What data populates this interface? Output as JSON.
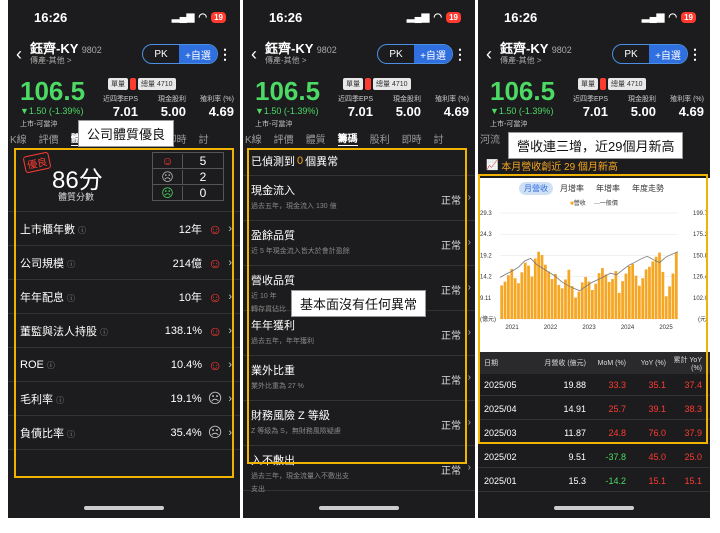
{
  "status": {
    "time": "16:26",
    "battery": "19"
  },
  "header": {
    "name": "鈺齊-KY",
    "code": "9802",
    "sub": "傳產-其他 >",
    "pk": "PK",
    "add": "+自選"
  },
  "quote": {
    "price": "106.5",
    "change": "▼1.50 (-1.39%)",
    "market": "上市-可當沖",
    "tag1": "單量",
    "tag2": "",
    "tag3": "總量 4710",
    "eps_label": "近四季EPS",
    "eps": "7.01",
    "div_label": "現金股利",
    "div": "5.00",
    "yield_label": "殖利率 (%)",
    "yield": "4.69"
  },
  "tabs": [
    "K線",
    "評價",
    "體質",
    "籌碼",
    "股利",
    "即時",
    "討"
  ],
  "tabs_p2": [
    "K線",
    "評價",
    "體質",
    "籌碼",
    "股利",
    "即時",
    "討"
  ],
  "tabs_p3": [
    "河流"
  ],
  "callouts": {
    "p1": "公司體質優良",
    "p2": "基本面沒有任何異常",
    "p3": "營收連三增，近29個月新高"
  },
  "health": {
    "badge": "優良",
    "score": "86分",
    "score_label": "體質分數",
    "counts": [
      {
        "icon": "☺",
        "n": "5"
      },
      {
        "icon": "☹",
        "n": "2"
      },
      {
        "icon": "☹",
        "n": "0"
      }
    ],
    "rows": [
      {
        "label": "上市櫃年數",
        "value": "12年",
        "face": "☺"
      },
      {
        "label": "公司規模",
        "value": "214億",
        "face": "☺"
      },
      {
        "label": "年年配息",
        "value": "10年",
        "face": "☺"
      },
      {
        "label": "董監與法人持股",
        "value": "138.1%",
        "face": "☺"
      },
      {
        "label": "ROE",
        "value": "10.4%",
        "face": "☺"
      },
      {
        "label": "毛利率",
        "value": "19.1%",
        "face": "☹"
      },
      {
        "label": "負債比率",
        "value": "35.4%",
        "face": "☹"
      }
    ]
  },
  "anomaly": {
    "prefix": "已偵測到",
    "count": "0",
    "suffix": "個異常",
    "rows": [
      {
        "title": "現金流入",
        "desc": "過去五年，現金流入 130 億",
        "status": "正常"
      },
      {
        "title": "盈餘品質",
        "desc": "近 5 年現金流入皆大於會計盈餘",
        "status": "正常"
      },
      {
        "title": "營收品質",
        "desc": "近 10 年",
        "desc2": "轉存貨佔比",
        "status": "正常"
      },
      {
        "title": "年年獲利",
        "desc": "過去五年，年年獲利",
        "status": "正常"
      },
      {
        "title": "業外比重",
        "desc": "業外比重為 27 %",
        "status": "正常"
      },
      {
        "title": "財務風險 Z 等級",
        "desc": "Z 等級為 S，無財務風險疑慮",
        "status": "正常"
      },
      {
        "title": "入不敷出",
        "desc": "過去三年，現金流量入不敷出支",
        "desc2": "支出",
        "status": "正常"
      }
    ]
  },
  "revenue": {
    "headline": "本月營收創近 29 個月新高",
    "chart_tabs": [
      "月營收",
      "月增率",
      "年增率",
      "年度走勢"
    ],
    "legend": [
      "營收",
      "一般價"
    ],
    "table_head": [
      "日期",
      "月營收 (億元)",
      "MoM (%)",
      "YoY (%)",
      "累計 YoY (%)"
    ],
    "rows": [
      {
        "date": "2025/05",
        "rev": "19.88",
        "mom": "33.3",
        "yoy": "35.1",
        "cum": "37.4",
        "mom_color": "#ff3b30",
        "yoy_color": "#ff3b30",
        "cum_color": "#ff3b30"
      },
      {
        "date": "2025/04",
        "rev": "14.91",
        "mom": "25.7",
        "yoy": "39.1",
        "cum": "38.3",
        "mom_color": "#ff3b30",
        "yoy_color": "#ff3b30",
        "cum_color": "#ff3b30"
      },
      {
        "date": "2025/03",
        "rev": "11.87",
        "mom": "24.8",
        "yoy": "76.0",
        "cum": "37.9",
        "mom_color": "#ff3b30",
        "yoy_color": "#ff3b30",
        "cum_color": "#ff3b30"
      },
      {
        "date": "2025/02",
        "rev": "9.51",
        "mom": "-37.8",
        "yoy": "45.0",
        "cum": "25.0",
        "mom_color": "#4cd964",
        "yoy_color": "#ff3b30",
        "cum_color": "#ff3b30"
      },
      {
        "date": "2025/01",
        "rev": "15.3",
        "mom": "-14.2",
        "yoy": "15.1",
        "cum": "15.1",
        "mom_color": "#4cd964",
        "yoy_color": "#ff3b30",
        "cum_color": "#ff3b30"
      }
    ]
  },
  "chart_data": {
    "type": "bar",
    "title": "",
    "y_left_ticks": [
      "29.3",
      "24.3",
      "19.2",
      "14.2",
      "9.11",
      "(億元)"
    ],
    "y_right_ticks": [
      "199.7",
      "175.2",
      "150.8",
      "126.4",
      "102.0",
      "(元)"
    ],
    "x_ticks": [
      "2021",
      "2022",
      "2023",
      "2024",
      "2025"
    ],
    "ylim": [
      4.1,
      29.3
    ],
    "bar_values": [
      12.1,
      13.0,
      14.5,
      16.0,
      13.8,
      12.6,
      15.2,
      17.5,
      16.8,
      14.2,
      18.5,
      20.1,
      19.3,
      17.0,
      15.4,
      13.6,
      14.8,
      12.2,
      11.4,
      13.5,
      15.8,
      11.9,
      9.2,
      10.6,
      12.8,
      14.1,
      13.0,
      11.0,
      12.5,
      15.0,
      16.2,
      14.7,
      12.9,
      13.6,
      15.5,
      10.3,
      13.1,
      14.9,
      16.7,
      17.2,
      14.4,
      12.0,
      13.8,
      15.9,
      16.5,
      17.8,
      18.9,
      19.88,
      15.3,
      9.51,
      11.87,
      14.91,
      19.88
    ],
    "line_values": [
      14.0,
      14.8,
      15.5,
      16.4,
      17.9,
      18.5,
      17.0,
      16.1,
      15.2,
      14.3,
      13.0,
      12.1,
      11.4,
      10.8,
      11.9,
      12.8,
      13.5,
      14.2,
      15.0,
      14.6,
      15.8,
      16.9,
      17.6,
      18.4,
      19.0,
      18.2,
      17.5,
      18.8,
      19.5,
      20.1
    ]
  }
}
